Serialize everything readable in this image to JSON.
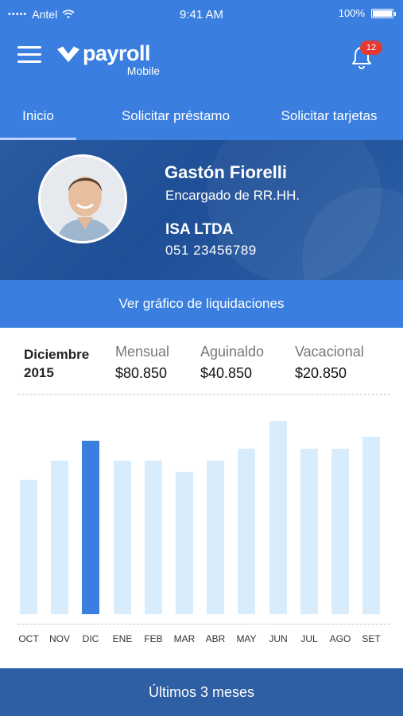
{
  "status_bar": {
    "signal": "•••••",
    "carrier": "Antel",
    "time": "9:41 AM",
    "battery": "100%"
  },
  "header": {
    "logo_text": "payroll",
    "logo_subtext": "Mobile",
    "notification_count": "12",
    "icons": [
      "menu-icon",
      "logo-icon",
      "bell-icon"
    ]
  },
  "tabs": [
    {
      "label": "Inicio",
      "active": true
    },
    {
      "label": "Solicitar préstamo",
      "active": false
    },
    {
      "label": "Solicitar tarjetas",
      "active": false
    }
  ],
  "profile": {
    "name": "Gastón Fiorelli",
    "role": "Encargado de RR.HH.",
    "company": "ISA LTDA",
    "phone": "051 23456789"
  },
  "chart_button_label": "Ver gráfico de liquidaciones",
  "summary": {
    "month": "Diciembre",
    "year": "2015",
    "metrics": [
      {
        "label": "Mensual",
        "value": "$80.850"
      },
      {
        "label": "Aguinaldo",
        "value": "$40.850"
      },
      {
        "label": "Vacacional",
        "value": "$20.850"
      }
    ]
  },
  "chart_data": {
    "type": "bar",
    "categories": [
      "OCT",
      "NOV",
      "DIC",
      "ENE",
      "FEB",
      "MAR",
      "ABR",
      "MAY",
      "JUN",
      "JUL",
      "AGO",
      "SET"
    ],
    "values": [
      0.68,
      0.78,
      0.88,
      0.78,
      0.78,
      0.72,
      0.78,
      0.84,
      0.98,
      0.84,
      0.84,
      0.9
    ],
    "highlighted": "DIC",
    "colors": {
      "bar": "#d8ecfc",
      "highlight": "#3a7fe0"
    }
  },
  "footer_label": "Últimos 3 meses",
  "colors": {
    "primary": "#3a7fe0",
    "dark": "#2e5ea3",
    "profile_bg": "#2a5aa0"
  }
}
